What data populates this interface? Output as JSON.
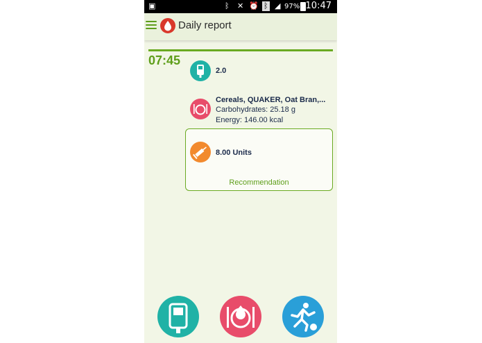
{
  "status_bar": {
    "battery": "97%",
    "time": "10:47"
  },
  "header": {
    "title": "Daily report"
  },
  "entry": {
    "time": "07:45",
    "glucose": {
      "value": "2.0"
    },
    "meal": {
      "name": "Cereals, QUAKER, Oat Bran,...",
      "carbs": "Carbohydrates: 25.18 g",
      "energy": "Energy: 146.00 kcal"
    },
    "insulin": {
      "value": "8.00 Units",
      "recommendation": "Recommendation"
    }
  },
  "colors": {
    "accent": "#6aaa21",
    "glucose": "#20b2a6",
    "meal": "#e84c6a",
    "insulin": "#f28a2e",
    "activity": "#2a9fd8",
    "logo": "#d9382b"
  }
}
